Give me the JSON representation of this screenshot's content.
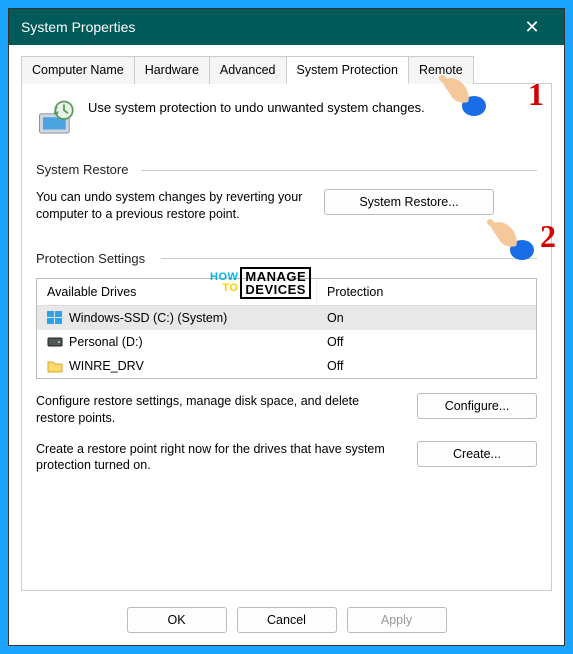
{
  "window": {
    "title": "System Properties"
  },
  "tabs": {
    "t0": "Computer Name",
    "t1": "Hardware",
    "t2": "Advanced",
    "t3": "System Protection",
    "t4": "Remote"
  },
  "intro": "Use system protection to undo unwanted system changes.",
  "groups": {
    "restore_label": "System Restore",
    "protect_label": "Protection Settings"
  },
  "restore": {
    "text": "You can undo system changes by reverting your computer to a previous restore point.",
    "button": "System Restore..."
  },
  "table": {
    "col1": "Available Drives",
    "col2": "Protection",
    "rows": [
      {
        "name": "Windows-SSD (C:) (System)",
        "prot": "On",
        "icon": "win"
      },
      {
        "name": "Personal (D:)",
        "prot": "Off",
        "icon": "hdd"
      },
      {
        "name": "WINRE_DRV",
        "prot": "Off",
        "icon": "folder"
      }
    ]
  },
  "configure": {
    "text": "Configure restore settings, manage disk space, and delete restore points.",
    "button": "Configure..."
  },
  "create": {
    "text": "Create a restore point right now for the drives that have system protection turned on.",
    "button": "Create..."
  },
  "footer": {
    "ok": "OK",
    "cancel": "Cancel",
    "apply": "Apply"
  },
  "watermark": {
    "how": "HOW",
    "to": "TO",
    "manage": "MANAGE",
    "devices": "DEVICES"
  },
  "annotations": {
    "one": "1",
    "two": "2"
  }
}
